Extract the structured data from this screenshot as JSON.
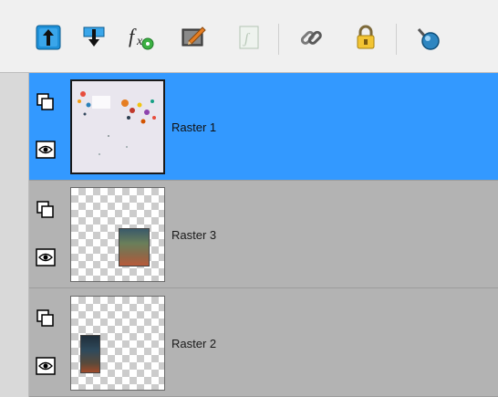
{
  "toolbar": {
    "buttons": [
      {
        "icon": "move-layer-up-icon",
        "label": "Move layer up"
      },
      {
        "icon": "move-layer-down-icon",
        "label": "Move layer down"
      },
      {
        "icon": "layer-effects-icon",
        "label": "Layer effects"
      },
      {
        "icon": "edit-layer-icon",
        "label": "Edit layer"
      },
      {
        "icon": "script-icon",
        "label": "Script"
      },
      {
        "icon": "link-icon",
        "label": "Link"
      },
      {
        "icon": "lock-icon",
        "label": "Lock"
      },
      {
        "icon": "clear-icon",
        "label": "Clear"
      }
    ],
    "colors": {
      "accent": "#3399ff",
      "arrow_blue": "#1e90d8"
    }
  },
  "layers": [
    {
      "name": "Raster 1",
      "selected": true,
      "thumbnail": "splatter-collage"
    },
    {
      "name": "Raster 3",
      "selected": false,
      "thumbnail": "small-photo"
    },
    {
      "name": "Raster 2",
      "selected": false,
      "thumbnail": "small-photo"
    }
  ]
}
